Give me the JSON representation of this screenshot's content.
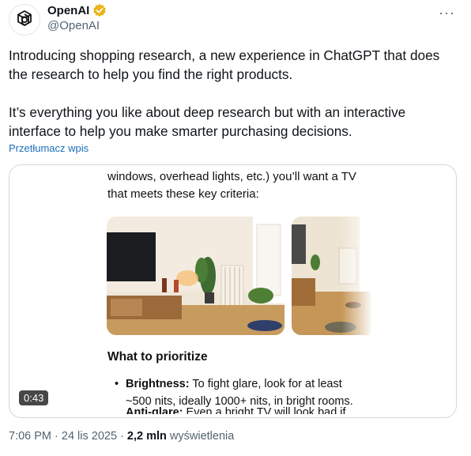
{
  "author": {
    "name": "OpenAI",
    "handle": "@OpenAI",
    "verified_color": "#e8b51a",
    "avatar_icon": "openai-logo-icon"
  },
  "menu_icon": "more-horizontal-icon",
  "tweet": {
    "paragraph1": "Introducing shopping research, a new experience in ChatGPT that does the research to help you find the right products.",
    "paragraph2": "It’s everything you like about deep research but with an interactive interface to help you make smarter purchasing decisions.",
    "translate_label": "Przetłumacz wpis"
  },
  "media": {
    "caption": "windows, overhead lights, etc.) you’ll want a TV that meets these key criteria:",
    "section_title": "What to prioritize",
    "bullet1_label": "Brightness:",
    "bullet1_text": " To fight glare, look for at least ~500 nits, ideally 1000+ nits, in bright rooms.",
    "bullet2_label": "Anti-glare:",
    "bullet2_text": " Even a bright TV will look bad if",
    "duration": "0:43"
  },
  "footer": {
    "time": "7:06 PM",
    "separator": " · ",
    "date": "24 lis 2025",
    "views_count": "2,2 mln",
    "views_label": " wyświetlenia"
  }
}
